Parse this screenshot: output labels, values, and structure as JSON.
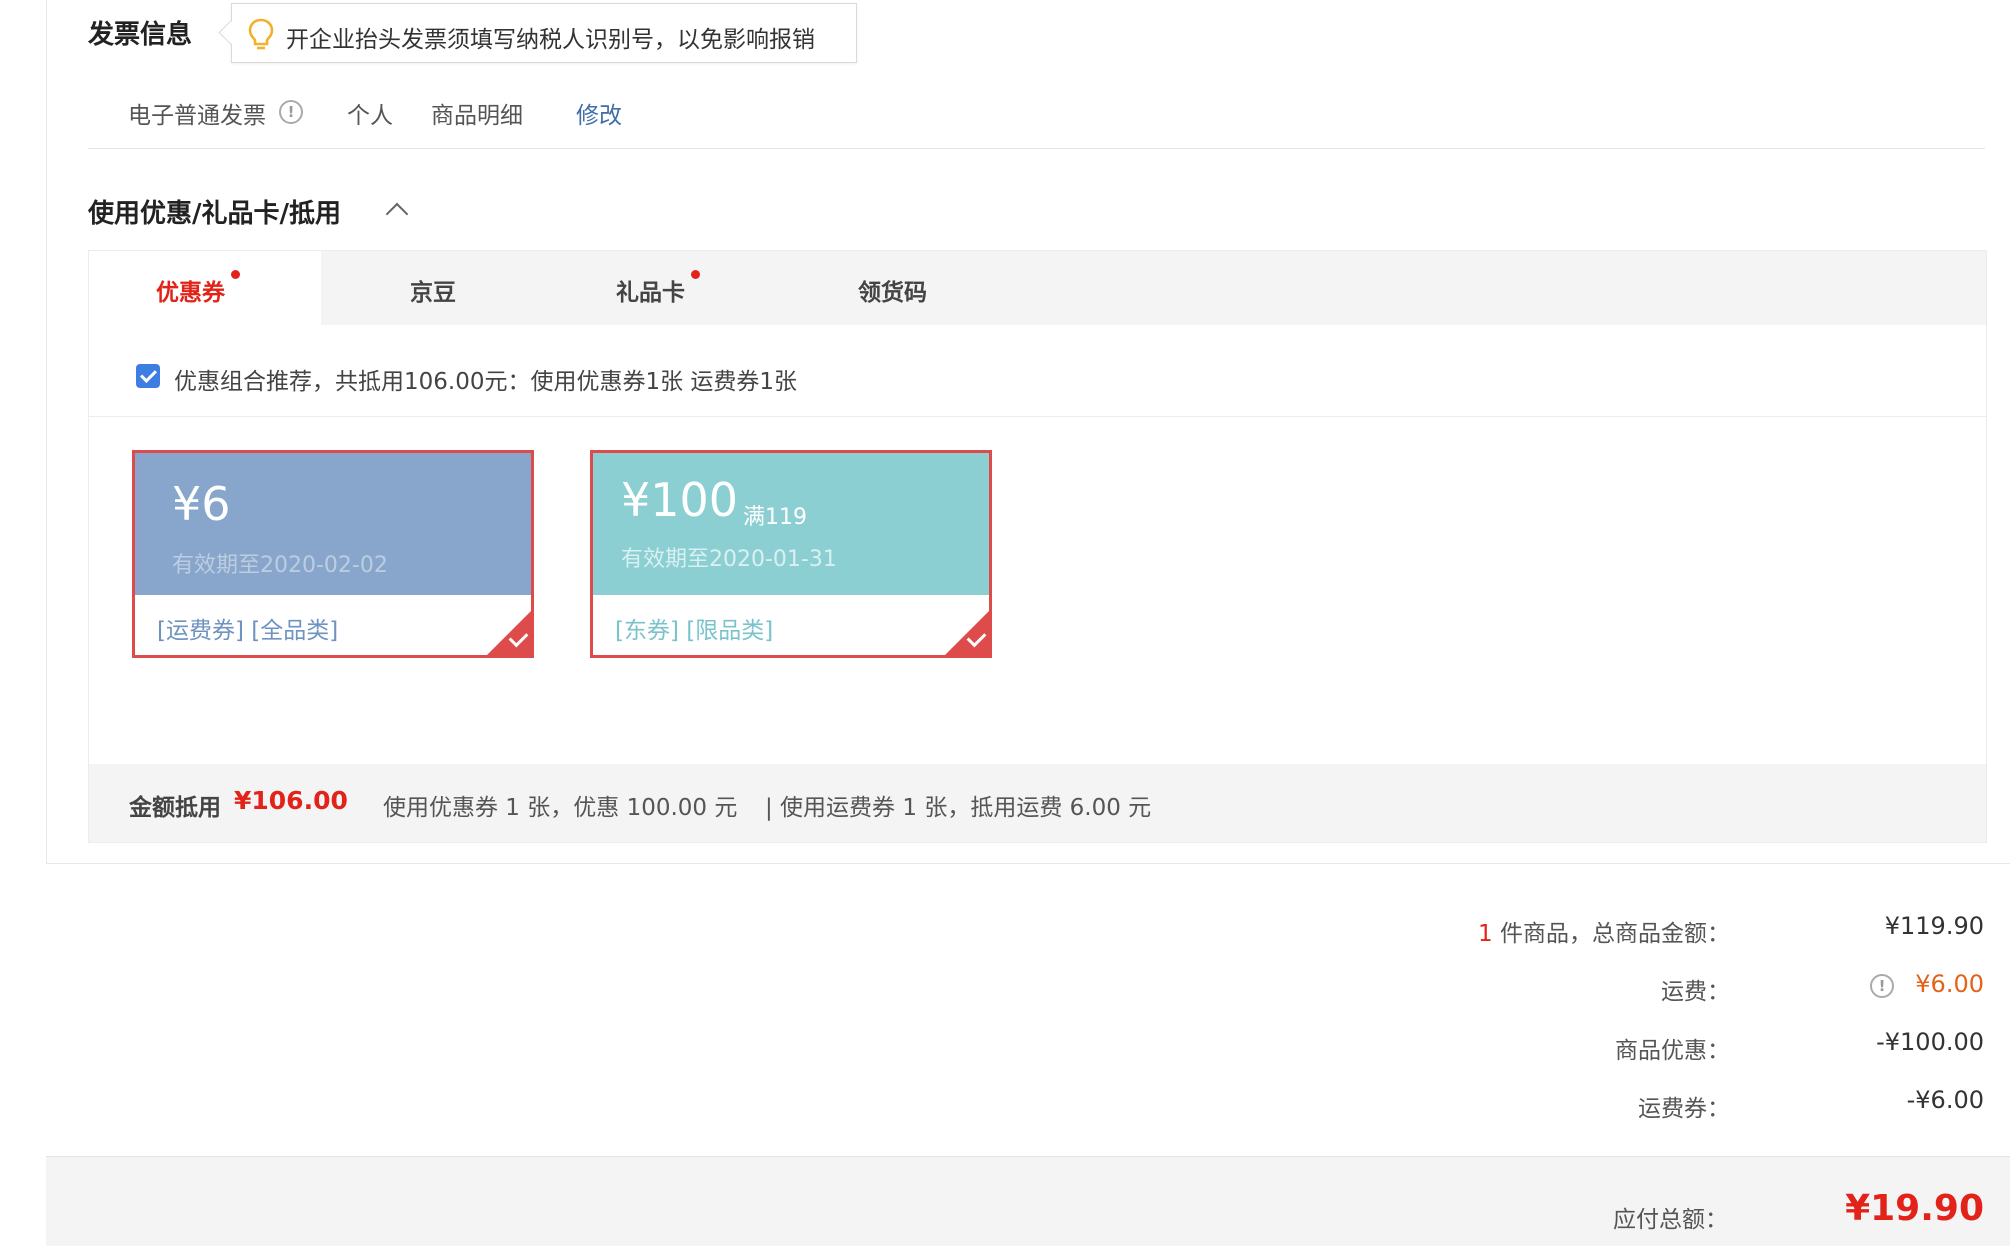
{
  "invoice": {
    "title": "发票信息",
    "tip": "开企业抬头发票须填写纳税人识别号，以免影响报销",
    "type": "电子普通发票",
    "header": "个人",
    "content": "商品明细",
    "edit_label": "修改"
  },
  "discount": {
    "title": "使用优惠/礼品卡/抵用",
    "tabs": [
      {
        "label": "优惠券",
        "has_dot": true,
        "active": true
      },
      {
        "label": "京豆",
        "has_dot": false,
        "active": false
      },
      {
        "label": "礼品卡",
        "has_dot": true,
        "active": false
      },
      {
        "label": "领货码",
        "has_dot": false,
        "active": false
      }
    ],
    "recommend_text": "优惠组合推荐，共抵用106.00元：使用优惠券1张 运费券1张",
    "recommend_checked": true,
    "coupons": [
      {
        "amount": "¥6",
        "condition": "",
        "valid": "有效期至2020-02-02",
        "tags": "[运费券] [全品类]",
        "bg_color": "#88a6cb",
        "valid_color": "#bccde2",
        "tag_color": "#6f93c0",
        "selected": true
      },
      {
        "amount": "¥100",
        "condition": "满119",
        "valid": "有效期至2020-01-31",
        "tags": "[东券] [限品类]",
        "bg_color": "#8ccfd3",
        "valid_color": "#d9f0f1",
        "tag_color": "#7ac3cb",
        "selected": true
      }
    ],
    "summary": {
      "label": "金额抵用",
      "amount": "¥106.00",
      "detail_coupon": "使用优惠券 1 张，优惠 100.00 元",
      "detail_shipping": "| 使用运费券 1 张，抵用运费 6.00 元"
    }
  },
  "totals": {
    "item_count": "1",
    "items_label": "件商品，总商品金额：",
    "items_value": "¥119.90",
    "shipping_label": "运费：",
    "shipping_value": "¥6.00",
    "discount_label": "商品优惠：",
    "discount_value": "-¥100.00",
    "shipping_coupon_label": "运费券：",
    "shipping_coupon_value": "-¥6.00",
    "payable_label": "应付总额：",
    "payable_value": "¥19.90"
  },
  "colors": {
    "accent_red": "#e2231a",
    "link_blue": "#3f6ea8",
    "shipping_orange": "#e4631b",
    "checkbox_blue": "#3e7de2"
  },
  "icons": {
    "tip": "lightbulb-icon",
    "info": "info-circle-icon",
    "collapse": "chevron-up-icon",
    "selected": "check-corner-icon"
  }
}
